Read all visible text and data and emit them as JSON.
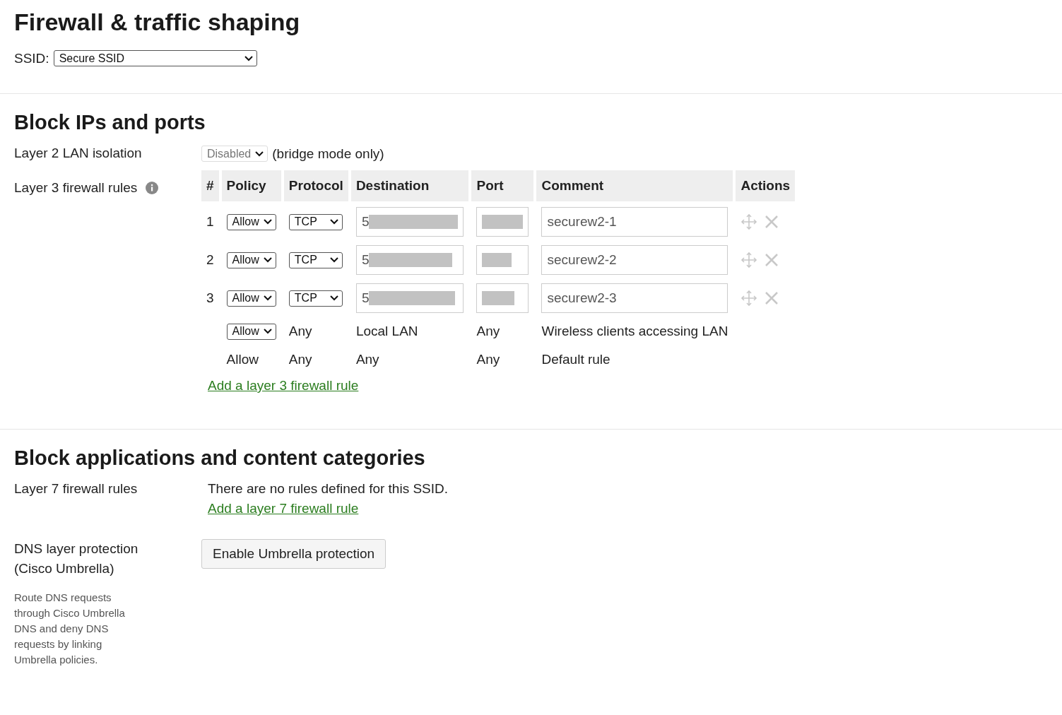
{
  "title": "Firewall & traffic shaping",
  "ssid": {
    "label": "SSID:",
    "value": "Secure SSID"
  },
  "block_ips": {
    "heading": "Block IPs and ports",
    "lan_isolation": {
      "label": "Layer 2 LAN isolation",
      "value": "Disabled",
      "disabled": true,
      "note": "(bridge mode only)"
    },
    "layer3": {
      "label": "Layer 3 firewall rules",
      "columns": [
        "#",
        "Policy",
        "Protocol",
        "Destination",
        "Port",
        "Comment",
        "Actions"
      ],
      "rules": [
        {
          "kind": "editable",
          "number": "1",
          "policy": "Allow",
          "protocol": "TCP",
          "destination": "5",
          "comment": "securew2-1",
          "redacted": true
        },
        {
          "kind": "editable",
          "number": "2",
          "policy": "Allow",
          "protocol": "TCP",
          "destination": "5",
          "comment": "securew2-2",
          "redacted": true
        },
        {
          "kind": "editable",
          "number": "3",
          "policy": "Allow",
          "protocol": "TCP",
          "destination": "5",
          "comment": "securew2-3",
          "redacted": true
        },
        {
          "kind": "policy_only",
          "policy": "Allow",
          "protocol": "Any",
          "destination": "Local LAN",
          "port": "Any",
          "comment": "Wireless clients accessing LAN"
        },
        {
          "kind": "fixed",
          "policy": "Allow",
          "protocol": "Any",
          "destination": "Any",
          "port": "Any",
          "comment": "Default rule"
        }
      ],
      "add_link": "Add a layer 3 firewall rule"
    }
  },
  "block_apps": {
    "heading": "Block applications and content categories",
    "layer7": {
      "label": "Layer 7 firewall rules",
      "message": "There are no rules defined for this SSID.",
      "add_link": "Add a layer 7 firewall rule"
    },
    "dns": {
      "label_lines": [
        "DNS layer protection",
        "(Cisco Umbrella)"
      ],
      "description": "Route DNS requests through Cisco Umbrella DNS and deny DNS requests by linking Umbrella policies.",
      "button": "Enable Umbrella protection"
    }
  }
}
